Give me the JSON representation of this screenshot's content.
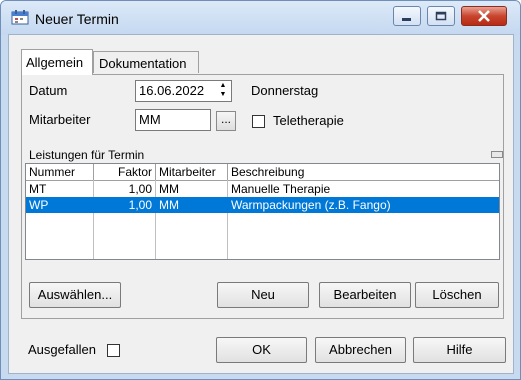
{
  "window": {
    "title": "Neuer Termin"
  },
  "tabs": [
    {
      "label": "Allgemein"
    },
    {
      "label": "Dokumentation"
    }
  ],
  "form": {
    "datum_label": "Datum",
    "datum_value": "16.06.2022",
    "weekday": "Donnerstag",
    "mitarbeiter_label": "Mitarbeiter",
    "mitarbeiter_value": "MM",
    "browse_label": "...",
    "teletherapie_label": "Teletherapie",
    "leistungen_label": "Leistungen für Termin"
  },
  "table": {
    "columns": [
      "Nummer",
      "Faktor",
      "Mitarbeiter",
      "Beschreibung"
    ],
    "rows": [
      {
        "nummer": "MT",
        "faktor": "1,00",
        "mitarbeiter": "MM",
        "beschreibung": "Manuelle Therapie",
        "selected": false
      },
      {
        "nummer": "WP",
        "faktor": "1,00",
        "mitarbeiter": "MM",
        "beschreibung": "Warmpackungen (z.B. Fango)",
        "selected": true
      }
    ]
  },
  "panel_buttons": {
    "auswaehlen": "Auswählen...",
    "neu": "Neu",
    "bearbeiten": "Bearbeiten",
    "loeschen": "Löschen"
  },
  "footer": {
    "ausgefallen_label": "Ausgefallen",
    "ok": "OK",
    "abbrechen": "Abbrechen",
    "hilfe": "Hilfe"
  },
  "colors": {
    "selection": "#0078d7",
    "close_button": "#c9452f"
  }
}
